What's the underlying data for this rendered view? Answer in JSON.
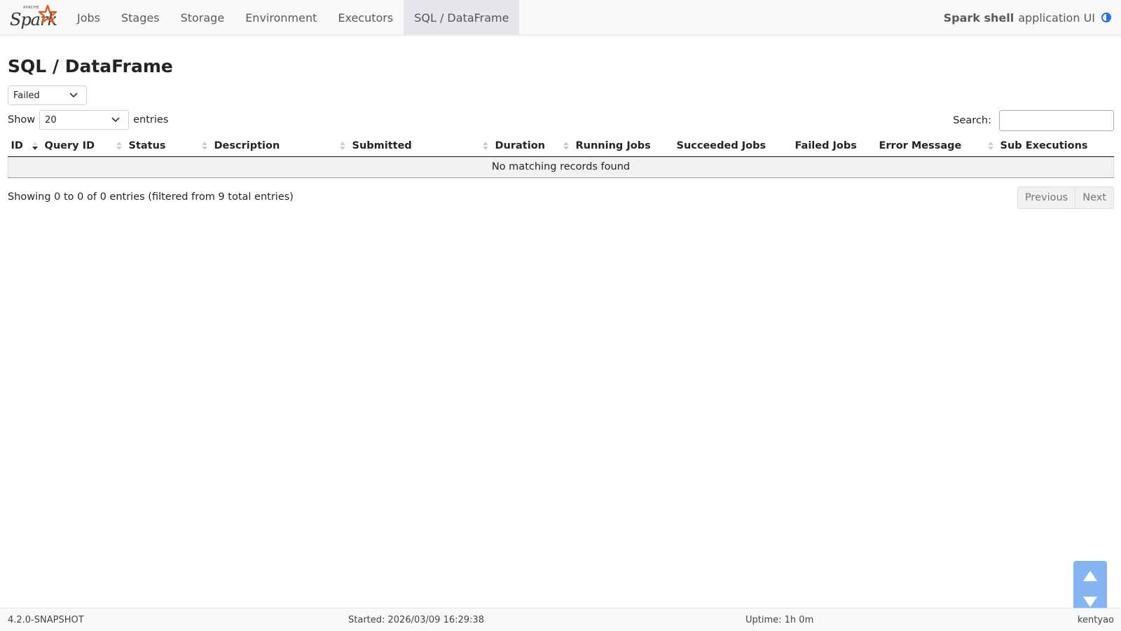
{
  "navbar": {
    "brand_small": "APACHE",
    "brand_text": "Spark",
    "tabs": [
      {
        "label": "Jobs"
      },
      {
        "label": "Stages"
      },
      {
        "label": "Storage"
      },
      {
        "label": "Environment"
      },
      {
        "label": "Executors"
      },
      {
        "label": "SQL / DataFrame"
      }
    ],
    "active_tab": "SQL / DataFrame",
    "app_name": "Spark shell",
    "app_suffix": "application UI",
    "accent_color": "#1a73e8"
  },
  "main": {
    "page_title": "SQL / DataFrame",
    "status_filter": {
      "selected": "Failed"
    },
    "show_label": "Show",
    "page_size": {
      "selected": "20"
    },
    "entries_label": "entries",
    "search_label": "Search:",
    "search_value": "",
    "table": {
      "columns": [
        {
          "label": "ID"
        },
        {
          "label": "Query ID"
        },
        {
          "label": "Status"
        },
        {
          "label": "Description"
        },
        {
          "label": "Submitted"
        },
        {
          "label": "Duration"
        },
        {
          "label": "Running Jobs"
        },
        {
          "label": "Succeeded Jobs"
        },
        {
          "label": "Failed Jobs"
        },
        {
          "label": "Error Message"
        },
        {
          "label": "Sub Executions"
        }
      ],
      "empty_message": "No matching records found"
    },
    "info": "Showing 0 to 0 of 0 entries (filtered from 9 total entries)",
    "pager": {
      "previous": "Previous",
      "next": "Next"
    }
  },
  "footer": {
    "version": "4.2.0-SNAPSHOT",
    "started": "Started: 2026/03/09 16:29:38",
    "uptime": "Uptime: 1h 0m",
    "user": "kentyao"
  }
}
